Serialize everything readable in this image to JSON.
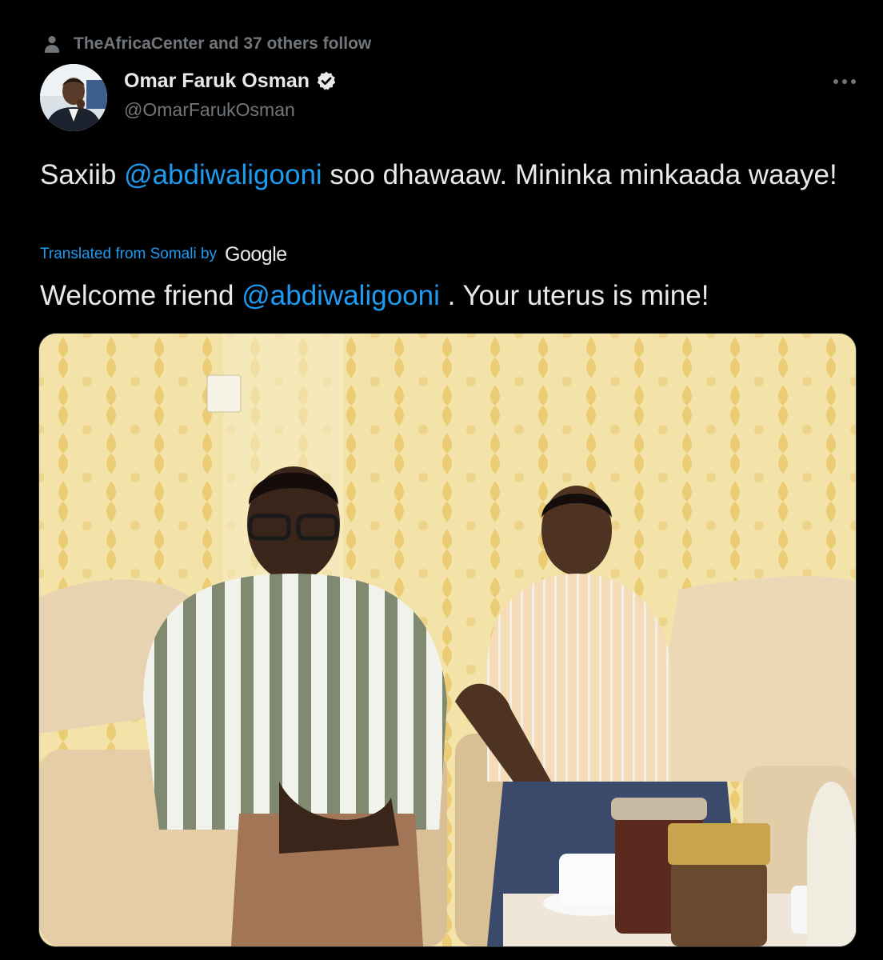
{
  "social_context": {
    "icon": "person-icon",
    "text": "TheAfricaCenter and 37 others follow"
  },
  "author": {
    "display_name": "Omar Faruk Osman",
    "handle": "@OmarFarukOsman",
    "verified": true,
    "verified_color": "#1d9bf0"
  },
  "tweet": {
    "text_before": "Saxiib ",
    "mention": "@abdiwaligooni",
    "text_after": " soo dhawaaw. Mininka minkaada waaye!"
  },
  "translation": {
    "label": "Translated from Somali by",
    "provider": "Google",
    "text_before": "Welcome friend ",
    "mention": "@abdiwaligooni",
    "text_after": " . Your uterus is mine!"
  },
  "colors": {
    "background": "#000000",
    "text": "#e7e9ea",
    "secondary": "#71767b",
    "accent": "#1d9bf0"
  }
}
